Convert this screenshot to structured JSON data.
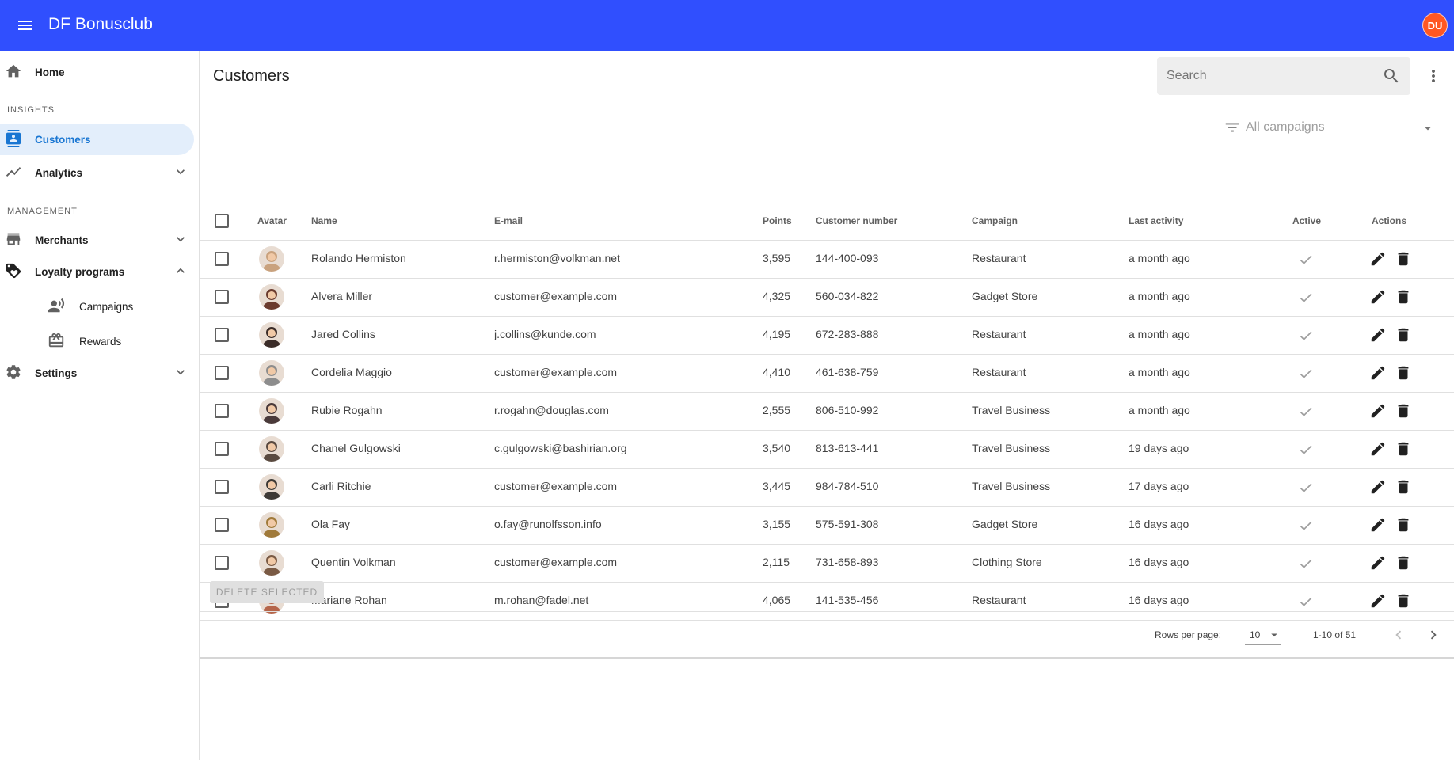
{
  "app": {
    "title": "DF Bonusclub",
    "user_initials": "DU",
    "accent_color": "#304ffe"
  },
  "sidebar": {
    "home_label": "Home",
    "insights_header": "INSIGHTS",
    "customers_label": "Customers",
    "analytics_label": "Analytics",
    "management_header": "MANAGEMENT",
    "merchants_label": "Merchants",
    "loyalty_label": "Loyalty programs",
    "campaigns_label": "Campaigns",
    "rewards_label": "Rewards",
    "settings_label": "Settings"
  },
  "page": {
    "title": "Customers",
    "search_placeholder": "Search",
    "filter_label": "All campaigns"
  },
  "table": {
    "headers": {
      "avatar": "Avatar",
      "name": "Name",
      "email": "E-mail",
      "points": "Points",
      "customer_number": "Customer number",
      "campaign": "Campaign",
      "last_activity": "Last activity",
      "active": "Active",
      "actions": "Actions"
    },
    "rows": [
      {
        "name": "Rolando Hermiston",
        "email": "r.hermiston@volkman.net",
        "points": "3,595",
        "number": "144-400-093",
        "campaign": "Restaurant",
        "last": "a month ago",
        "avatar_color": "#c9a27e"
      },
      {
        "name": "Alvera Miller",
        "email": "customer@example.com",
        "points": "4,325",
        "number": "560-034-822",
        "campaign": "Gadget Store",
        "last": "a month ago",
        "avatar_color": "#6b3b2e"
      },
      {
        "name": "Jared Collins",
        "email": "j.collins@kunde.com",
        "points": "4,195",
        "number": "672-283-888",
        "campaign": "Restaurant",
        "last": "a month ago",
        "avatar_color": "#3a2c28"
      },
      {
        "name": "Cordelia Maggio",
        "email": "customer@example.com",
        "points": "4,410",
        "number": "461-638-759",
        "campaign": "Restaurant",
        "last": "a month ago",
        "avatar_color": "#8d8d8d"
      },
      {
        "name": "Rubie Rogahn",
        "email": "r.rogahn@douglas.com",
        "points": "2,555",
        "number": "806-510-992",
        "campaign": "Travel Business",
        "last": "a month ago",
        "avatar_color": "#4a3a3a"
      },
      {
        "name": "Chanel Gulgowski",
        "email": "c.gulgowski@bashirian.org",
        "points": "3,540",
        "number": "813-613-441",
        "campaign": "Travel Business",
        "last": "19 days ago",
        "avatar_color": "#5a4a40"
      },
      {
        "name": "Carli Ritchie",
        "email": "customer@example.com",
        "points": "3,445",
        "number": "984-784-510",
        "campaign": "Travel Business",
        "last": "17 days ago",
        "avatar_color": "#3e3a36"
      },
      {
        "name": "Ola Fay",
        "email": "o.fay@runolfsson.info",
        "points": "3,155",
        "number": "575-591-308",
        "campaign": "Gadget Store",
        "last": "16 days ago",
        "avatar_color": "#a07a3a"
      },
      {
        "name": "Quentin Volkman",
        "email": "customer@example.com",
        "points": "2,115",
        "number": "731-658-893",
        "campaign": "Clothing Store",
        "last": "16 days ago",
        "avatar_color": "#7a5a44"
      },
      {
        "name": "Mariane Rohan",
        "email": "m.rohan@fadel.net",
        "points": "4,065",
        "number": "141-535-456",
        "campaign": "Restaurant",
        "last": "16 days ago",
        "avatar_color": "#b5654a"
      }
    ]
  },
  "bulk": {
    "delete_selected_label": "DELETE SELECTED"
  },
  "pagination": {
    "rows_per_page_label": "Rows per page:",
    "rows_per_page_value": "10",
    "range_label": "1-10 of 51"
  }
}
